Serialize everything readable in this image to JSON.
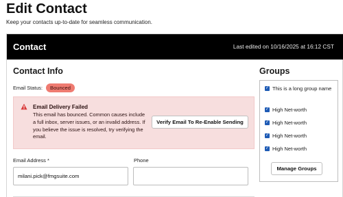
{
  "page": {
    "title": "Edit Contact",
    "subtitle": "Keep your contacts up-to-date for seamless communication."
  },
  "header": {
    "title": "Contact",
    "last_edited": "Last edited on 10/16/2025 at 16:12 CST"
  },
  "contact_info": {
    "title": "Contact Info",
    "email_status_label": "Email Status:",
    "email_status_value": "Bounced",
    "status_color": "#ef7b71"
  },
  "alert": {
    "icon": "warning-triangle-icon",
    "title": "Email Delivery Failed",
    "body": "This email has bounced. Common causes include a full inbox, server issues, or an invalid address. If you believe the issue is resolved, try verifying the email.",
    "button_label": "Verify Email To Re-Enable Sending",
    "background_color": "#f7dede",
    "icon_color": "#d93a3a"
  },
  "fields": {
    "email_label": "Email Address *",
    "email_value": "milani.pick@fmgsuite.com",
    "phone_label": "Phone",
    "phone_value": ""
  },
  "groups": {
    "title": "Groups",
    "items": [
      {
        "label": "This is a long group name",
        "checked": true
      },
      {
        "label": "High Net-worth",
        "checked": true
      },
      {
        "label": "High Net-worth",
        "checked": true
      },
      {
        "label": "High Net-worth",
        "checked": true
      },
      {
        "label": "High Net-worth",
        "checked": true
      }
    ],
    "manage_label": "Manage Groups",
    "checkbox_color": "#1e5bb5"
  }
}
